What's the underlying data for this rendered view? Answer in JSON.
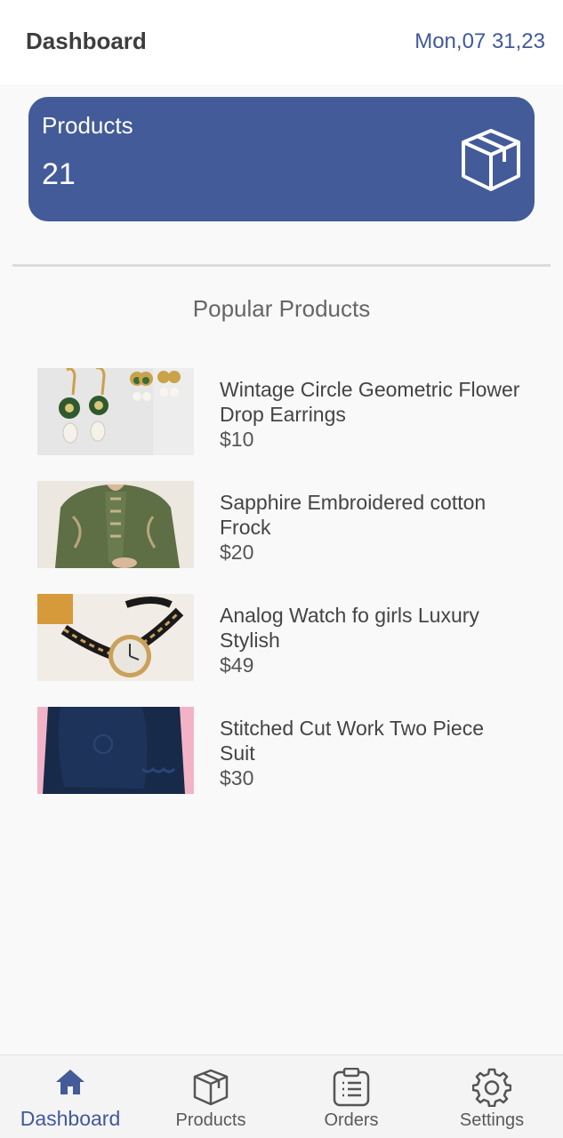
{
  "header": {
    "title": "Dashboard",
    "date": "Mon,07 31,23"
  },
  "stat_card": {
    "label": "Products",
    "value": "21",
    "icon": "box-icon"
  },
  "section": {
    "title": "Popular Products"
  },
  "products": [
    {
      "name": "Wintage Circle Geometric Flower Drop Earrings",
      "price": "$10",
      "image": "earrings"
    },
    {
      "name": "Sapphire Embroidered cotton Frock",
      "price": "$20",
      "image": "green-frock"
    },
    {
      "name": "Analog Watch fo girls Luxury Stylish",
      "price": "$49",
      "image": "watch"
    },
    {
      "name": "Stitched Cut Work Two Piece Suit",
      "price": "$30",
      "image": "navy-suit"
    }
  ],
  "nav": [
    {
      "label": "Dashboard",
      "icon": "home-icon",
      "active": true
    },
    {
      "label": "Products",
      "icon": "box-icon",
      "active": false
    },
    {
      "label": "Orders",
      "icon": "orders-icon",
      "active": false
    },
    {
      "label": "Settings",
      "icon": "gear-icon",
      "active": false
    }
  ],
  "colors": {
    "accent": "#435b99",
    "date": "#41599a"
  }
}
